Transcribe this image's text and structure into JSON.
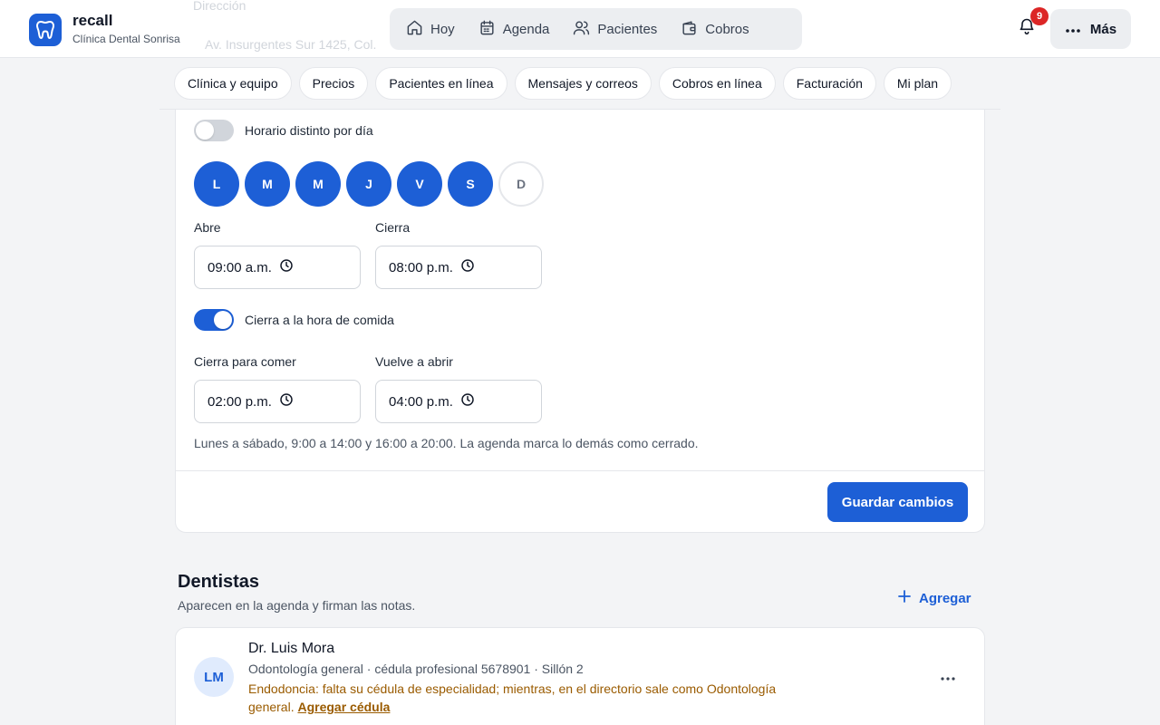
{
  "brand": {
    "name": "recall",
    "subtitle": "Clínica Dental Sonrisa"
  },
  "scrolled_behind": {
    "label": "Dirección",
    "value": "Av. Insurgentes Sur 1425, Col."
  },
  "nav": {
    "items": [
      {
        "label": "Hoy",
        "icon": "home-icon"
      },
      {
        "label": "Agenda",
        "icon": "calendar-icon"
      },
      {
        "label": "Pacientes",
        "icon": "users-icon"
      },
      {
        "label": "Cobros",
        "icon": "wallet-icon"
      }
    ]
  },
  "notifications": {
    "count": "9"
  },
  "more_label": "Más",
  "subtabs": [
    "Clínica y equipo",
    "Precios",
    "Pacientes en línea",
    "Mensajes y correos",
    "Cobros en línea",
    "Facturación",
    "Mi plan"
  ],
  "schedule": {
    "per_day_toggle": {
      "label": "Horario distinto por día",
      "on": false
    },
    "days": [
      {
        "label": "L",
        "on": true
      },
      {
        "label": "M",
        "on": true
      },
      {
        "label": "M",
        "on": true
      },
      {
        "label": "J",
        "on": true
      },
      {
        "label": "V",
        "on": true
      },
      {
        "label": "S",
        "on": true
      },
      {
        "label": "D",
        "on": false
      }
    ],
    "opens": {
      "label": "Abre",
      "value": "09:00 a.m."
    },
    "closes": {
      "label": "Cierra",
      "value": "08:00 p.m."
    },
    "lunch_toggle": {
      "label": "Cierra a la hora de comida",
      "on": true
    },
    "lunch_start": {
      "label": "Cierra para comer",
      "value": "02:00 p.m."
    },
    "lunch_end": {
      "label": "Vuelve a abrir",
      "value": "04:00 p.m."
    },
    "summary": "Lunes a sábado, 9:00 a 14:00 y 16:00 a 20:00. La agenda marca lo demás como cerrado.",
    "save_label": "Guardar cambios"
  },
  "dentists": {
    "title": "Dentistas",
    "subtitle": "Aparecen en la agenda y firman las notas.",
    "add_label": "Agregar",
    "items": [
      {
        "initials": "LM",
        "name": "Dr. Luis Mora",
        "meta": "Odontología general · cédula profesional 5678901 · Sillón 2",
        "warning": "Endodoncia: falta su cédula de especialidad; mientras, en el directorio sale como Odontología general.",
        "warning_link": "Agregar cédula"
      }
    ]
  },
  "colors": {
    "accent": "#1d5fd6",
    "warning": "#9a5b00",
    "badge": "#dc2626"
  }
}
